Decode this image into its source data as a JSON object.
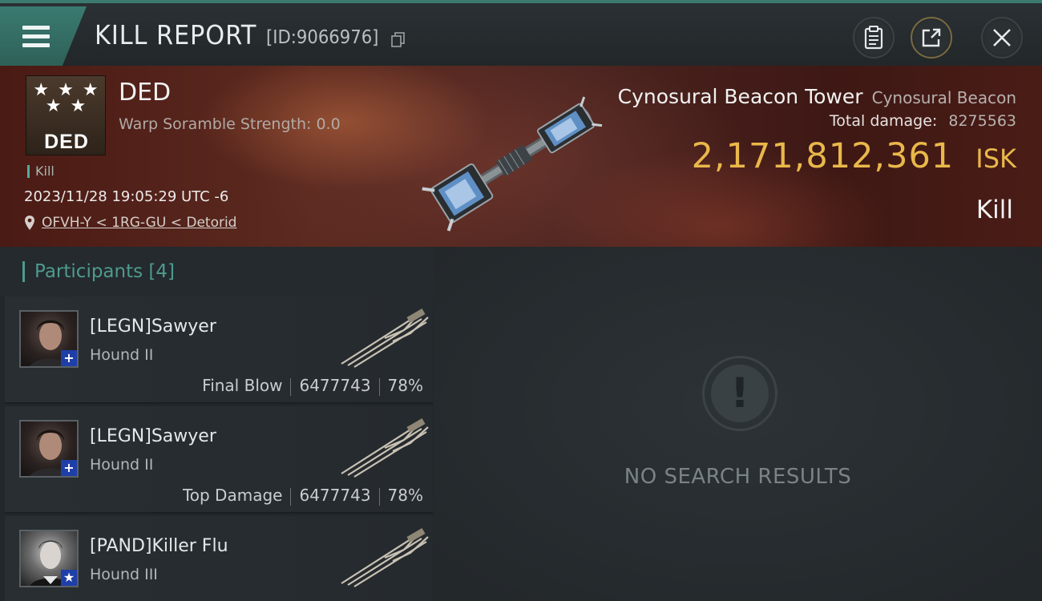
{
  "header": {
    "title": "KILL REPORT",
    "id_label": "[ID:9066976]",
    "icons": [
      "menu-icon",
      "copy-icon",
      "clipboard-icon",
      "share-icon",
      "close-icon"
    ]
  },
  "victim": {
    "badge_text": "DED",
    "name": "DED",
    "subtitle": "Warp Soramble Strength: 0.0",
    "tag": "Kill",
    "datetime": "2023/11/28 19:05:29 UTC -6",
    "location": "OFVH-Y < 1RG-GU < Detorid"
  },
  "target": {
    "name": "Cynosural Beacon Tower",
    "type": "Cynosural Beacon",
    "damage_label": "Total damage:",
    "damage_value": "8275563",
    "isk_value": "2,171,812,361",
    "isk_unit": "ISK",
    "result": "Kill"
  },
  "participants": {
    "title": "Participants",
    "count": "[4]",
    "items": [
      {
        "name": "[LEGN]Sawyer",
        "ship": "Hound II",
        "role": "Final Blow",
        "damage": "6477743",
        "percent": "78%",
        "badge": "+"
      },
      {
        "name": "[LEGN]Sawyer",
        "ship": "Hound II",
        "role": "Top Damage",
        "damage": "6477743",
        "percent": "78%",
        "badge": "+"
      },
      {
        "name": "[PAND]Killer Flu",
        "ship": "Hound III",
        "role": "",
        "damage": "",
        "percent": "",
        "badge": "★"
      }
    ]
  },
  "results": {
    "empty_text": "NO SEARCH RESULTS"
  },
  "colors": {
    "accent_teal": "#4f9a8e",
    "isk_gold": "#e9b84a",
    "banner_red": "#5c2a20"
  }
}
